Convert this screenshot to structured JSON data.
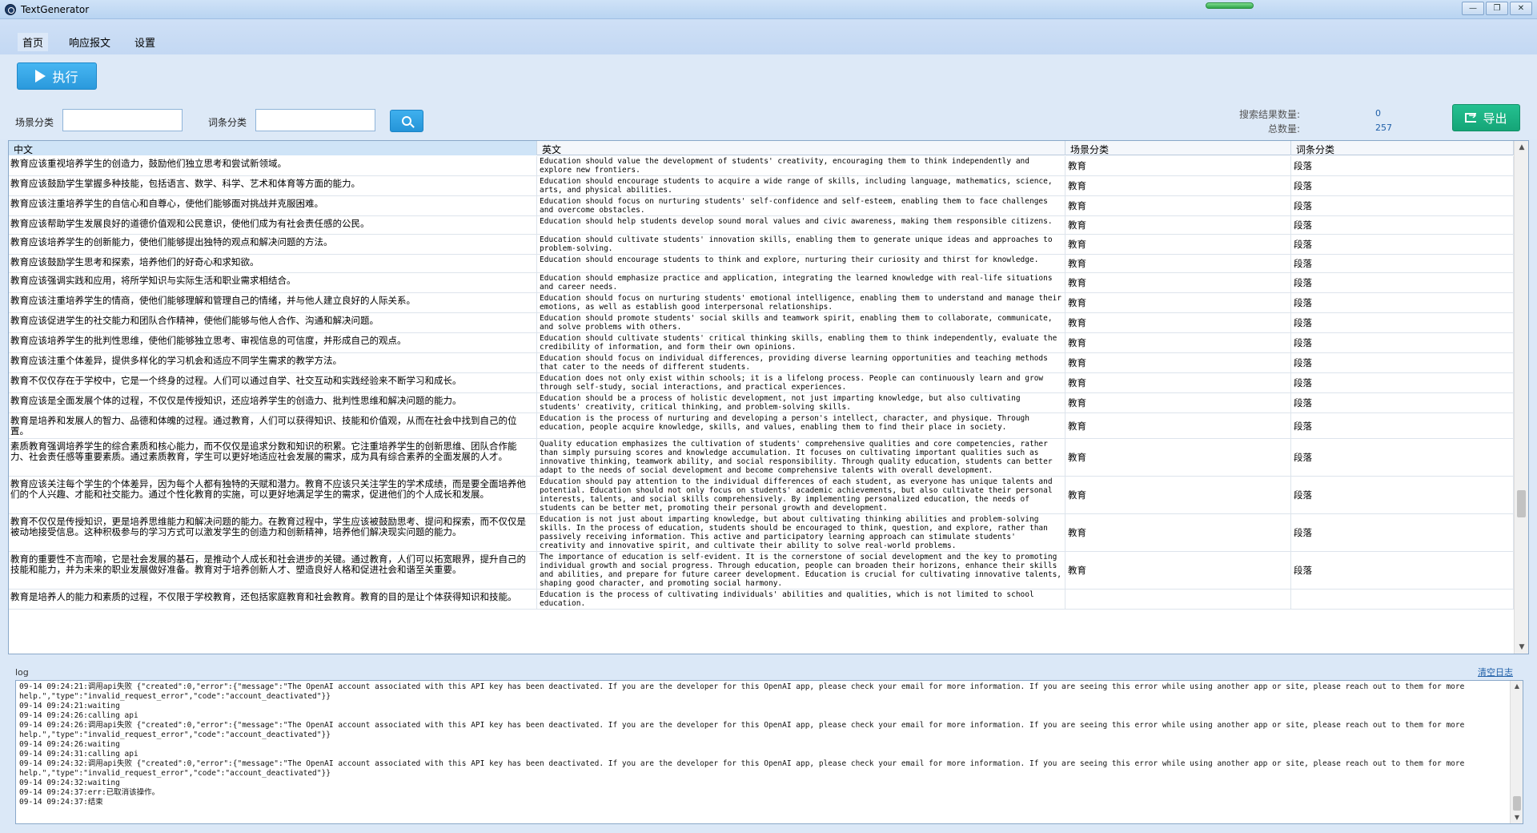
{
  "window": {
    "title": "TextGenerator",
    "minimize": "—",
    "restore": "❐",
    "close": "✕"
  },
  "menu": {
    "items": [
      "首页",
      "响应报文",
      "设置"
    ]
  },
  "toolbar": {
    "exec_label": "执行"
  },
  "filter": {
    "scene_label": "场景分类",
    "term_label": "词条分类",
    "scene_value": "",
    "term_value": ""
  },
  "stats": {
    "search_count_label": "搜索结果数量:",
    "search_count": "0",
    "total_label": "总数量:",
    "total": "257"
  },
  "export_label": "导出",
  "grid": {
    "headers": [
      "中文",
      "英文",
      "场景分类",
      "词条分类"
    ],
    "rows": [
      {
        "zh": "教育应该重视培养学生的创造力，鼓励他们独立思考和尝试新领域。",
        "en": "Education should value the development of students' creativity, encouraging them to think independently and explore new frontiers.",
        "scene": "教育",
        "cat": "段落"
      },
      {
        "zh": "教育应该鼓励学生掌握多种技能，包括语言、数学、科学、艺术和体育等方面的能力。",
        "en": "Education should encourage students to acquire a wide range of skills, including language, mathematics, science, arts, and physical abilities.",
        "scene": "教育",
        "cat": "段落"
      },
      {
        "zh": "教育应该注重培养学生的自信心和自尊心，使他们能够面对挑战并克服困难。",
        "en": "Education should focus on nurturing students' self-confidence and self-esteem, enabling them to face challenges and overcome obstacles.",
        "scene": "教育",
        "cat": "段落"
      },
      {
        "zh": "教育应该帮助学生发展良好的道德价值观和公民意识，使他们成为有社会责任感的公民。",
        "en": "Education should help students develop sound moral values and civic awareness, making them responsible citizens.",
        "scene": "教育",
        "cat": "段落"
      },
      {
        "zh": "教育应该培养学生的创新能力，使他们能够提出独特的观点和解决问题的方法。",
        "en": "Education should cultivate students' innovation skills, enabling them to generate unique ideas and approaches to problem-solving.",
        "scene": "教育",
        "cat": "段落"
      },
      {
        "zh": "教育应该鼓励学生思考和探索，培养他们的好奇心和求知欲。",
        "en": "Education should encourage students to think and explore, nurturing their curiosity and thirst for knowledge.",
        "scene": "教育",
        "cat": "段落"
      },
      {
        "zh": "教育应该强调实践和应用，将所学知识与实际生活和职业需求相结合。",
        "en": "Education should emphasize practice and application, integrating the learned knowledge with real-life situations and career needs.",
        "scene": "教育",
        "cat": "段落"
      },
      {
        "zh": "教育应该注重培养学生的情商，使他们能够理解和管理自己的情绪，并与他人建立良好的人际关系。",
        "en": "Education should focus on nurturing students' emotional intelligence, enabling them to understand and manage their emotions, as well as establish good interpersonal relationships.",
        "scene": "教育",
        "cat": "段落"
      },
      {
        "zh": "教育应该促进学生的社交能力和团队合作精神，使他们能够与他人合作、沟通和解决问题。",
        "en": "Education should promote students' social skills and teamwork spirit, enabling them to collaborate, communicate, and solve problems with others.",
        "scene": "教育",
        "cat": "段落"
      },
      {
        "zh": "教育应该培养学生的批判性思维，使他们能够独立思考、审视信息的可信度，并形成自己的观点。",
        "en": "Education should cultivate students' critical thinking skills, enabling them to think independently, evaluate the credibility of information, and form their own opinions.",
        "scene": "教育",
        "cat": "段落"
      },
      {
        "zh": "教育应该注重个体差异，提供多样化的学习机会和适应不同学生需求的教学方法。",
        "en": "Education should focus on individual differences, providing diverse learning opportunities and teaching methods that cater to the needs of different students.",
        "scene": "教育",
        "cat": "段落"
      },
      {
        "zh": "教育不仅仅存在于学校中，它是一个终身的过程。人们可以通过自学、社交互动和实践经验来不断学习和成长。",
        "en": "Education does not only exist within schools; it is a lifelong process. People can continuously learn and grow through self-study, social interactions, and practical experiences.",
        "scene": "教育",
        "cat": "段落"
      },
      {
        "zh": "教育应该是全面发展个体的过程，不仅仅是传授知识，还应培养学生的创造力、批判性思维和解决问题的能力。",
        "en": "Education should be a process of holistic development, not just imparting knowledge, but also cultivating students' creativity, critical thinking, and problem-solving skills.",
        "scene": "教育",
        "cat": "段落"
      },
      {
        "zh": "教育是培养和发展人的智力、品德和体魄的过程。通过教育，人们可以获得知识、技能和价值观，从而在社会中找到自己的位置。",
        "en": "Education is the process of nurturing and developing a person's intellect, character, and physique. Through education, people acquire knowledge, skills, and values, enabling them to find their place in society.",
        "scene": "教育",
        "cat": "段落"
      },
      {
        "zh": "素质教育强调培养学生的综合素质和核心能力，而不仅仅是追求分数和知识的积累。它注重培养学生的创新思维、团队合作能力、社会责任感等重要素质。通过素质教育，学生可以更好地适应社会发展的需求，成为具有综合素养的全面发展的人才。",
        "en": "Quality education emphasizes the cultivation of students' comprehensive qualities and core competencies, rather than simply pursuing scores and knowledge accumulation. It focuses on cultivating important qualities such as innovative thinking, teamwork ability, and social responsibility. Through quality education, students can better adapt to the needs of social development and become comprehensive talents with overall development.",
        "scene": "教育",
        "cat": "段落"
      },
      {
        "zh": "教育应该关注每个学生的个体差异，因为每个人都有独特的天赋和潜力。教育不应该只关注学生的学术成绩，而是要全面培养他们的个人兴趣、才能和社交能力。通过个性化教育的实施，可以更好地满足学生的需求，促进他们的个人成长和发展。",
        "en": "Education should pay attention to the individual differences of each student, as everyone has unique talents and potential. Education should not only focus on students' academic achievements, but also cultivate their personal interests, talents, and social skills comprehensively. By implementing personalized education, the needs of students can be better met, promoting their personal growth and development.",
        "scene": "教育",
        "cat": "段落"
      },
      {
        "zh": "教育不仅仅是传授知识，更是培养思维能力和解决问题的能力。在教育过程中，学生应该被鼓励思考、提问和探索，而不仅仅是被动地接受信息。这种积极参与的学习方式可以激发学生的创造力和创新精神，培养他们解决现实问题的能力。",
        "en": "Education is not just about imparting knowledge, but about cultivating thinking abilities and problem-solving skills. In the process of education, students should be encouraged to think, question, and explore, rather than passively receiving information. This active and participatory learning approach can stimulate students' creativity and innovative spirit, and cultivate their ability to solve real-world problems.",
        "scene": "教育",
        "cat": "段落"
      },
      {
        "zh": "教育的重要性不言而喻，它是社会发展的基石，是推动个人成长和社会进步的关键。通过教育，人们可以拓宽眼界，提升自己的技能和能力，并为未来的职业发展做好准备。教育对于培养创新人才、塑造良好人格和促进社会和谐至关重要。",
        "en": "The importance of education is self-evident. It is the cornerstone of social development and the key to promoting individual growth and social progress. Through education, people can broaden their horizons, enhance their skills and abilities, and prepare for future career development. Education is crucial for cultivating innovative talents, shaping good character, and promoting social harmony.",
        "scene": "教育",
        "cat": "段落"
      },
      {
        "zh": "教育是培养人的能力和素质的过程，不仅限于学校教育，还包括家庭教育和社会教育。教育的目的是让个体获得知识和技能。",
        "en": "Education is the process of cultivating individuals' abilities and qualities, which is not limited to school education.",
        "scene": "",
        "cat": ""
      }
    ]
  },
  "log": {
    "label": "log",
    "clear_label": "清空日志",
    "lines": [
      "09-14 09:24:21:调用api失败 {\"created\":0,\"error\":{\"message\":\"The OpenAI account associated with this API key has been deactivated. If you are the developer for this OpenAI app, please check your email for more information. If you are seeing this error while using another app or site, please reach out to them for more help.\",\"type\":\"invalid_request_error\",\"code\":\"account_deactivated\"}}",
      "09-14 09:24:21:waiting",
      "09-14 09:24:26:calling api",
      "09-14 09:24:26:调用api失败 {\"created\":0,\"error\":{\"message\":\"The OpenAI account associated with this API key has been deactivated. If you are the developer for this OpenAI app, please check your email for more information. If you are seeing this error while using another app or site, please reach out to them for more help.\",\"type\":\"invalid_request_error\",\"code\":\"account_deactivated\"}}",
      "09-14 09:24:26:waiting",
      "09-14 09:24:31:calling api",
      "09-14 09:24:32:调用api失败 {\"created\":0,\"error\":{\"message\":\"The OpenAI account associated with this API key has been deactivated. If you are the developer for this OpenAI app, please check your email for more information. If you are seeing this error while using another app or site, please reach out to them for more help.\",\"type\":\"invalid_request_error\",\"code\":\"account_deactivated\"}}",
      "09-14 09:24:32:waiting",
      "09-14 09:24:37:err:已取消该操作。",
      "09-14 09:24:37:结束"
    ]
  }
}
